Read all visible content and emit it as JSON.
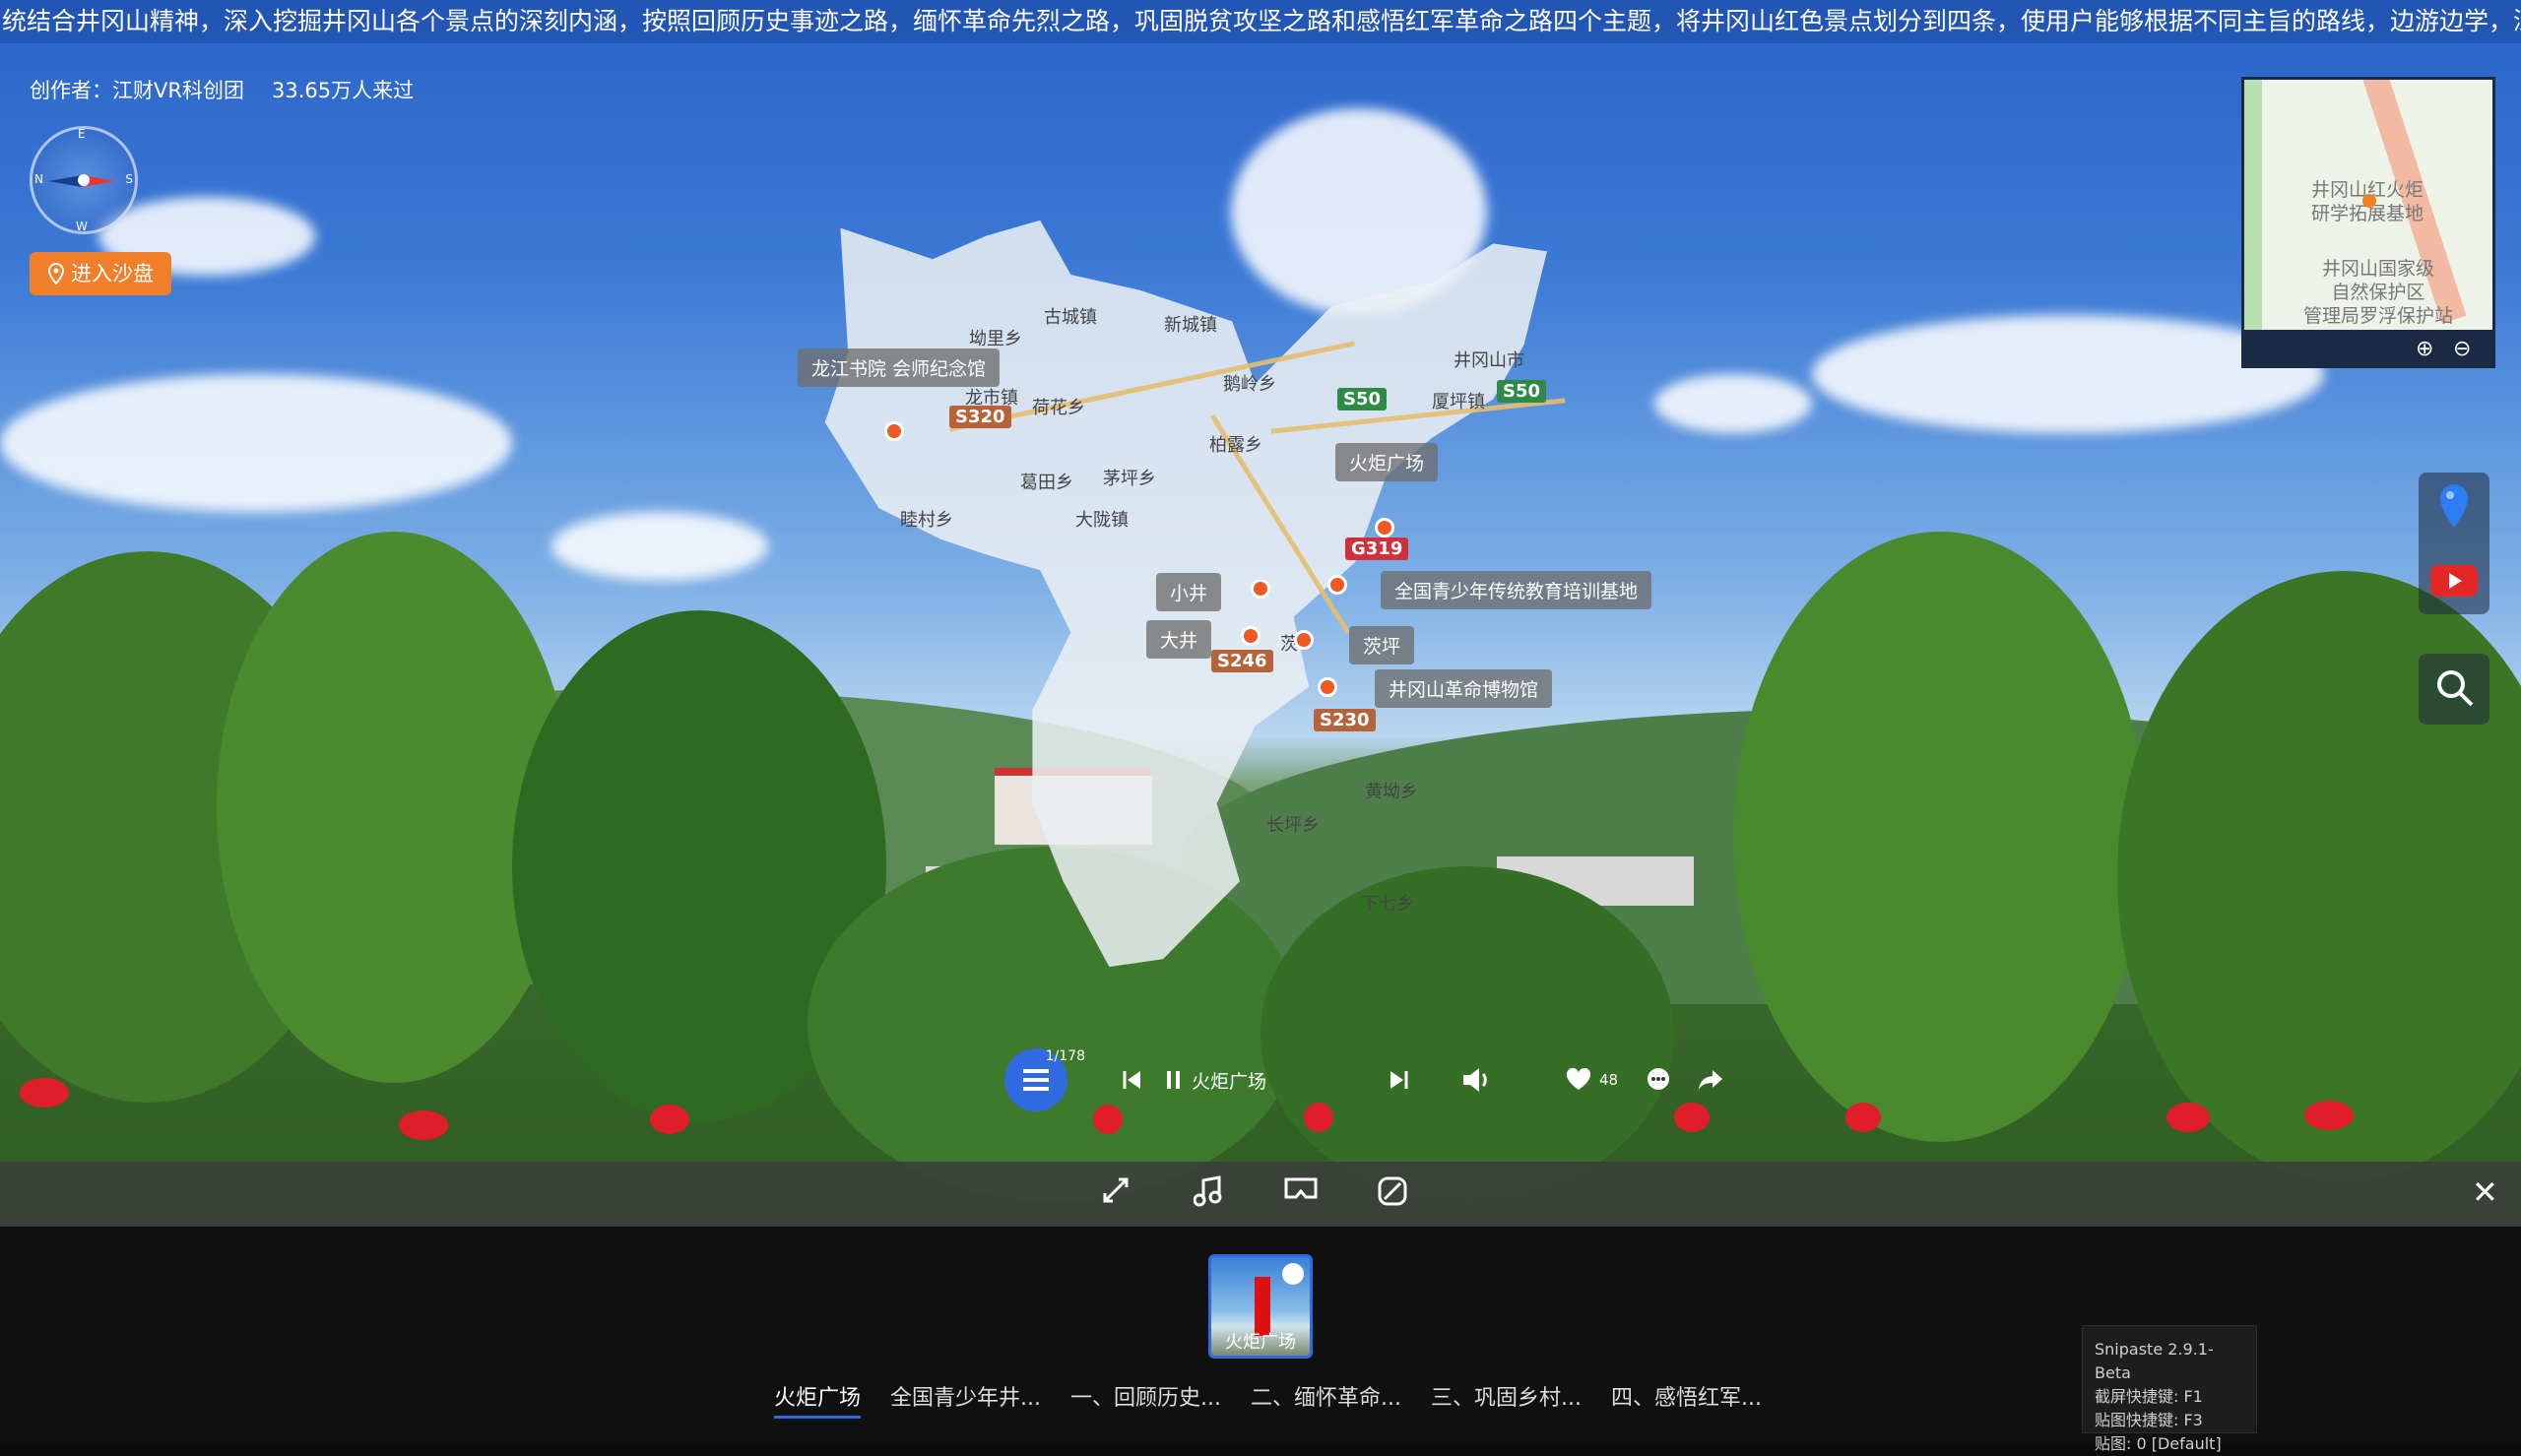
{
  "marquee": {
    "text": "统结合井冈山精神，深入挖掘井冈山各个景点的深刻内涵，按照回顾历史事迹之路，缅怀革命先烈之路，巩固脱贫攻坚之路和感悟红军革命之路四个主题，将井冈山红色景点划分到四条，使用户能够根据不同主旨的路线，边游边学，深刻理解"
  },
  "header": {
    "creator": "创作者：江财VR科创团",
    "visits": "33.65万人来过"
  },
  "compass": {
    "labels": {
      "n": "N",
      "e": "E",
      "s": "S",
      "w": "W"
    }
  },
  "sandbox": {
    "label": "进入沙盘"
  },
  "minimap": {
    "label_1": "井冈山红火炬\n研学拓展基地",
    "label_2": "井冈山国家级\n自然保护区\n管理局罗浮保护站",
    "zoom_in": "⊕",
    "zoom_out": "⊖"
  },
  "map": {
    "tags": {
      "longjiang": "龙江书院 会师纪念馆",
      "huoju": "火炬广场",
      "xiaojing": "小井",
      "dajing": "大井",
      "quanguo": "全国青少年传统教育培训基地",
      "ciping": "茨坪",
      "museum": "井冈山革命博物馆"
    },
    "towns": {
      "gucheng": "古城镇",
      "xincheng": "新城镇",
      "aoli": "坳里乡",
      "longshi": "龙市镇",
      "hehua": "荷花乡",
      "pengling": "鹅岭乡",
      "baiLu": "柏露乡",
      "getian": "葛田乡",
      "maoping": "茅坪乡",
      "dalong": "大陇镇",
      "jiecun": "睦村乡",
      "jgs": "井冈山市",
      "xiaping": "厦坪镇",
      "huangao": "黄坳乡",
      "changping": "长坪乡",
      "xiaqi": "下七乡",
      "cip": "茨"
    },
    "highways": {
      "s320": "S320",
      "s50a": "S50",
      "s50b": "S50",
      "g319": "G319",
      "s246": "S246",
      "s230": "S230"
    }
  },
  "player": {
    "page": "1/178",
    "title": "火炬广场",
    "likes": "48"
  },
  "toolbar": {
    "fullscreen_icon": "expand-icon",
    "music_icon": "music-icon",
    "vr_icon": "vr-icon",
    "gyro_icon": "gyro-icon"
  },
  "bottom": {
    "thumb_label": "火炬广场",
    "categories": [
      "火炬广场",
      "全国青少年井...",
      "一、回顾历史...",
      "二、缅怀革命...",
      "三、巩固乡村...",
      "四、感悟红军..."
    ]
  },
  "snipaste": {
    "line1": "Snipaste 2.9.1-Beta",
    "line2": "截屏快捷键: F1",
    "line3": "贴图快捷键: F3",
    "line4": "贴图: 0 [Default]"
  }
}
